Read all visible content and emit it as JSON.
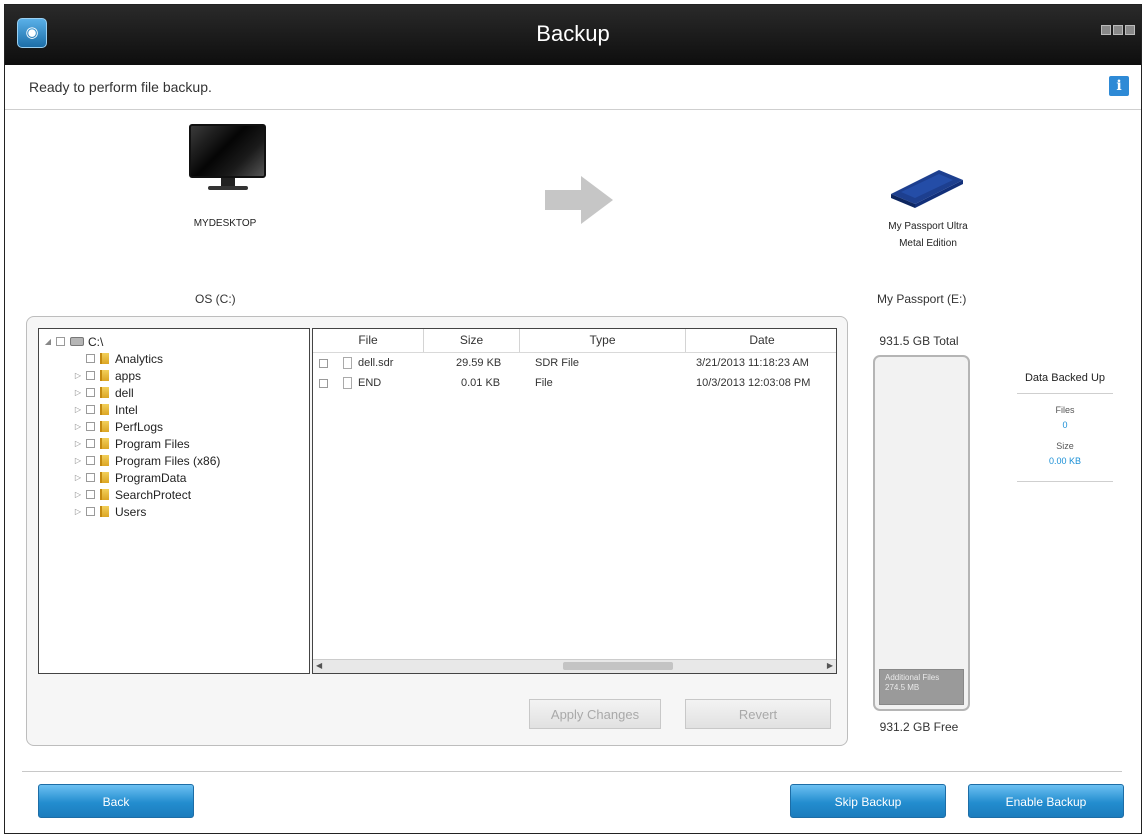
{
  "window": {
    "title": "Backup"
  },
  "status": {
    "message": "Ready to perform file backup."
  },
  "source": {
    "computer_name": "MYDESKTOP",
    "drive_label": "OS (C:)"
  },
  "destination": {
    "device_name_line1": "My Passport Ultra",
    "device_name_line2": "Metal Edition",
    "drive_label": "My Passport (E:)",
    "total": "931.5 GB Total",
    "free": "931.2 GB Free",
    "additional_files_label": "Additional Files",
    "additional_files_size": "274.5 MB"
  },
  "tree": {
    "root": "C:\\",
    "folders": [
      "Analytics",
      "apps",
      "dell",
      "Intel",
      "PerfLogs",
      "Program Files",
      "Program Files (x86)",
      "ProgramData",
      "SearchProtect",
      "Users"
    ]
  },
  "filelist": {
    "columns": [
      "File",
      "Size",
      "Type",
      "Date"
    ],
    "rows": [
      {
        "file": "dell.sdr",
        "size": "29.59 KB",
        "type": "SDR File",
        "date": "3/21/2013 11:18:23 AM"
      },
      {
        "file": "END",
        "size": "0.01 KB",
        "type": "File",
        "date": "10/3/2013 12:03:08 PM"
      }
    ]
  },
  "buttons": {
    "apply_changes": "Apply Changes",
    "revert": "Revert",
    "back": "Back",
    "skip_backup": "Skip Backup",
    "enable_backup": "Enable Backup"
  },
  "data_backed_up": {
    "title": "Data Backed Up",
    "files_label": "Files",
    "files_value": "0",
    "size_label": "Size",
    "size_value": "0.00 KB"
  },
  "colors": {
    "accent": "#2a8fd4",
    "title_bar": "#111111",
    "link_value": "#1a8fd6"
  }
}
